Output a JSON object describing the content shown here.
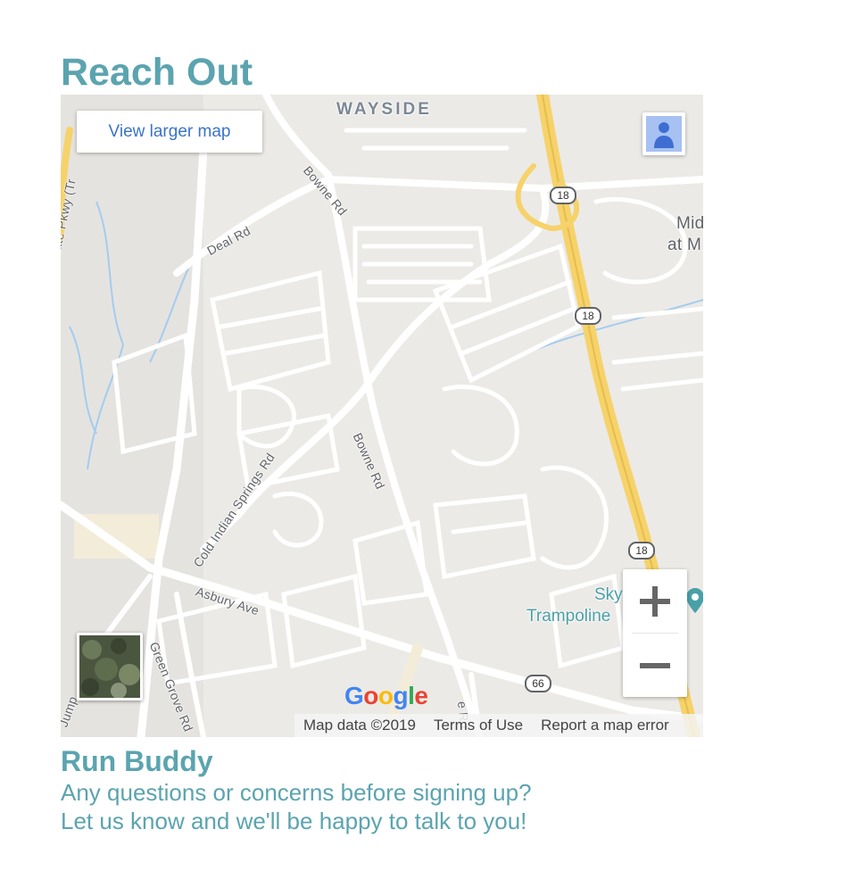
{
  "section": {
    "heading": "Reach Out"
  },
  "map": {
    "controls": {
      "view_larger_label": "View larger map",
      "zoom_in_label": "+",
      "zoom_out_label": "−"
    },
    "labels": {
      "wayside": "WAYSIDE",
      "bowne_rd_north": "Bowne Rd",
      "bowne_rd_south": "Bowne Rd",
      "deal_rd": "Deal Rd",
      "state_pkwy": "State Pkwy (Tr",
      "cold_indian_springs": "Cold Indian Springs Rd",
      "asbury_ave": "Asbury Ave",
      "green_grove_rd": "Green Grove Rd",
      "jump": "Jump",
      "bottom_rd": "e Rd",
      "mid_line1": "Mid",
      "mid_line2": "at M",
      "sky_line1": "Sky",
      "sky_line2": "Trampoline"
    },
    "routes": [
      "18",
      "18",
      "18",
      "66"
    ],
    "logo_text": "Google",
    "attribution": {
      "map_data": "Map data ©2019",
      "terms": "Terms of Use",
      "report": "Report a map error"
    },
    "colors": {
      "background": "#eceae6",
      "road": "#ffffff",
      "highway": "#f6d26b",
      "water": "#a3ccf0",
      "accent": "#5ba4af"
    }
  },
  "footer": {
    "title": "Run Buddy",
    "line1": "Any questions or concerns before signing up?",
    "line2": "Let us know and we'll be happy to talk to you!"
  }
}
